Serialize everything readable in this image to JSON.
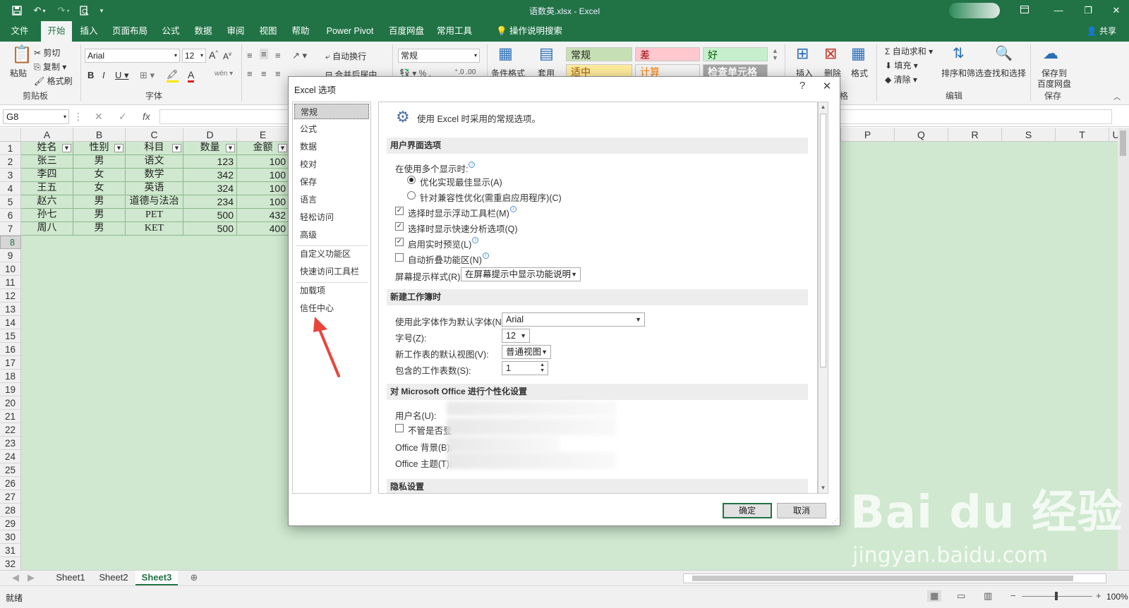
{
  "window": {
    "title": "语数英.xlsx  -  Excel",
    "share_label": "共享"
  },
  "menu_tabs": [
    "文件",
    "开始",
    "插入",
    "页面布局",
    "公式",
    "数据",
    "审阅",
    "视图",
    "帮助",
    "Power Pivot",
    "百度网盘",
    "常用工具",
    "操作说明搜索"
  ],
  "ribbon": {
    "paste": "粘贴",
    "cut": "剪切",
    "copy": "复制",
    "format_painter": "格式刷",
    "clipboard_group": "剪贴板",
    "font_name": "Arial",
    "font_size": "12",
    "font_group": "字体",
    "wrap_text": "自动换行",
    "merge_center": "合并后居中",
    "number_format": "常规",
    "conditional_format": "条件格式",
    "table_format": "套用",
    "style_normal": "常规",
    "style_bad": "差",
    "style_good": "好",
    "style_neutral": "适中",
    "style_calc": "计算",
    "style_check": "检查单元格",
    "insert": "插入",
    "delete": "删除",
    "format": "格式",
    "cells_group": "单元格",
    "autosum": "自动求和",
    "fill": "填充",
    "clear": "清除",
    "sort_filter": "排序和筛选",
    "find_select": "查找和选择",
    "edit_group": "编辑",
    "save_baidu_1": "保存到",
    "save_baidu_2": "百度网盘",
    "save_group": "保存"
  },
  "formula_bar": {
    "name_box": "G8",
    "fx": "fx"
  },
  "grid": {
    "columns": [
      "A",
      "B",
      "C",
      "D",
      "E",
      "P",
      "Q",
      "R",
      "S",
      "T",
      "U"
    ],
    "rows": [
      "1",
      "2",
      "3",
      "4",
      "5",
      "6",
      "7",
      "8",
      "9",
      "10",
      "11",
      "12",
      "13",
      "14",
      "15",
      "16",
      "17",
      "18",
      "19",
      "20",
      "21",
      "22",
      "23",
      "24",
      "25",
      "26",
      "27",
      "28",
      "29",
      "30",
      "31",
      "32"
    ],
    "headers": [
      "姓名",
      "性别",
      "科目",
      "数量",
      "金额"
    ],
    "data": [
      [
        "张三",
        "男",
        "语文",
        "123",
        "100"
      ],
      [
        "李四",
        "女",
        "数学",
        "342",
        "100"
      ],
      [
        "王五",
        "女",
        "英语",
        "324",
        "100"
      ],
      [
        "赵六",
        "男",
        "道德与法治",
        "234",
        "100"
      ],
      [
        "孙七",
        "男",
        "PET",
        "500",
        "432"
      ],
      [
        "周八",
        "男",
        "KET",
        "500",
        "400"
      ]
    ]
  },
  "sheet_tabs": [
    "Sheet1",
    "Sheet2",
    "Sheet3"
  ],
  "status": {
    "ready": "就绪",
    "zoom": "100%"
  },
  "dialog": {
    "title": "Excel 选项",
    "help": "?",
    "close": "✕",
    "nav": [
      "常规",
      "公式",
      "数据",
      "校对",
      "保存",
      "语言",
      "轻松访问",
      "高级",
      "自定义功能区",
      "快速访问工具栏",
      "加载项",
      "信任中心"
    ],
    "intro": "使用 Excel 时采用的常规选项。",
    "sections": {
      "ui": "用户界面选项",
      "new_wb": "新建工作簿时",
      "personalize": "对 Microsoft Office 进行个性化设置",
      "privacy": "隐私设置"
    },
    "multi_display_label": "在使用多个显示时:",
    "radio_best": "优化实现最佳显示(A)",
    "radio_compat": "针对兼容性优化(需重启应用程序)(C)",
    "chk_minitoolbar": "选择时显示浮动工具栏(M)",
    "chk_quickanalysis": "选择时显示快速分析选项(Q)",
    "chk_livepreview": "启用实时预览(L)",
    "chk_collapse": "自动折叠功能区(N)",
    "tooltip_label": "屏幕提示样式(R):",
    "tooltip_value": "在屏幕提示中显示功能说明",
    "font_label": "使用此字体作为默认字体(N):",
    "font_value": "Arial",
    "size_label": "字号(Z):",
    "size_value": "12",
    "view_label": "新工作表的默认视图(V):",
    "view_value": "普通视图",
    "sheets_label": "包含的工作表数(S):",
    "sheets_value": "1",
    "username_label": "用户名(U):",
    "always_label": "不管是否登",
    "background_label": "Office 背景(B):",
    "theme_label": "Office 主题(T):",
    "ok": "确定",
    "cancel": "取消"
  },
  "watermark": {
    "main": "Bai du 经验",
    "sub": "jingyan.baidu.com"
  },
  "colors": {
    "excel_green": "#217346",
    "grid_bg": "#cfe8cf",
    "arrow": "#e8453c"
  }
}
